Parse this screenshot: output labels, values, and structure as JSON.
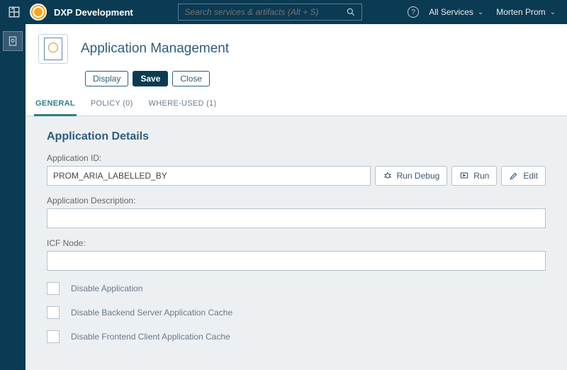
{
  "topbar": {
    "brand": "DXP Development",
    "search_placeholder": "Search services & artifacts (Alt + S)",
    "all_services": "All Services",
    "user_name": "Morten Prom"
  },
  "page": {
    "title": "Application Management",
    "actions": {
      "display": "Display",
      "save": "Save",
      "close": "Close"
    }
  },
  "tabs": {
    "general": "GENERAL",
    "policy": "POLICY (0)",
    "where_used": "WHERE-USED (1)"
  },
  "details": {
    "section_title": "Application Details",
    "app_id_label": "Application ID:",
    "app_id_value": "PROM_ARIA_LABELLED_BY",
    "run_debug": "Run Debug",
    "run": "Run",
    "edit": "Edit",
    "app_desc_label": "Application Description:",
    "app_desc_value": "",
    "icf_label": "ICF Node:",
    "icf_value": "",
    "disable_app": "Disable Application",
    "disable_backend": "Disable Backend Server Application Cache",
    "disable_frontend": "Disable Frontend Client Application Cache"
  }
}
